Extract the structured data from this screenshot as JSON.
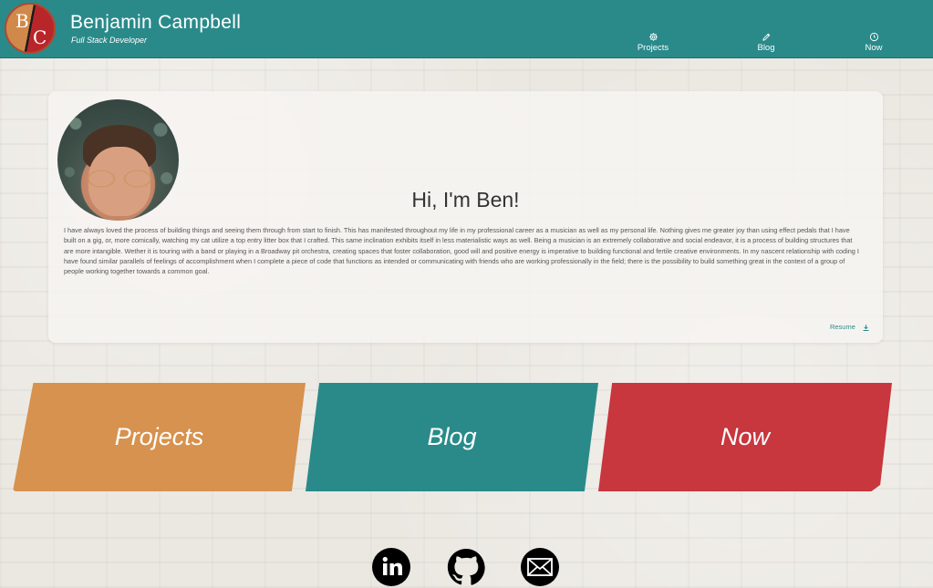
{
  "header": {
    "logo_letters": [
      "B",
      "C"
    ],
    "name": "Benjamin Campbell",
    "subtitle": "Full Stack Developer",
    "nav": [
      {
        "label": "Projects",
        "icon": "gear-icon"
      },
      {
        "label": "Blog",
        "icon": "pencil-icon"
      },
      {
        "label": "Now",
        "icon": "clock-icon"
      }
    ],
    "color": "#2a8a8a"
  },
  "intro": {
    "greeting": "Hi, I'm Ben!",
    "bio": "I have always loved the process of building things and seeing them through from start to finish. This has manifested throughout my life in my professional career as a musician as well as my personal life. Nothing gives me greater joy than using effect pedals that I have built on a gig, or, more comically, watching my cat utilize a top entry litter box that I crafted. This same inclination exhibits itself in less materialistic ways as well. Being a musician is an extremely collaborative and social endeavor, it is a process of building structures that are more intangible. Wether it is touring with a band or playing in a Broadway pit orchestra, creating spaces that foster collaboration, good will and positive energy is imperative to building functional and fertile creative environments. In my nascent relationship with coding I have found similar parallels of feelings of accomplishment when I complete a piece of code that functions as intended or communicating with friends who are working professionally in the field; there is the possibility to build something great in the context of a group of people working together towards a common goal.",
    "resume_label": "Resume",
    "resume_icon": "download-icon"
  },
  "tiles": [
    {
      "label": "Projects",
      "color": "#d6924e"
    },
    {
      "label": "Blog",
      "color": "#2a8a8a"
    },
    {
      "label": "Now",
      "color": "#c8363e"
    }
  ],
  "social": [
    {
      "icon": "linkedin-icon"
    },
    {
      "icon": "github-icon"
    },
    {
      "icon": "email-icon"
    }
  ]
}
